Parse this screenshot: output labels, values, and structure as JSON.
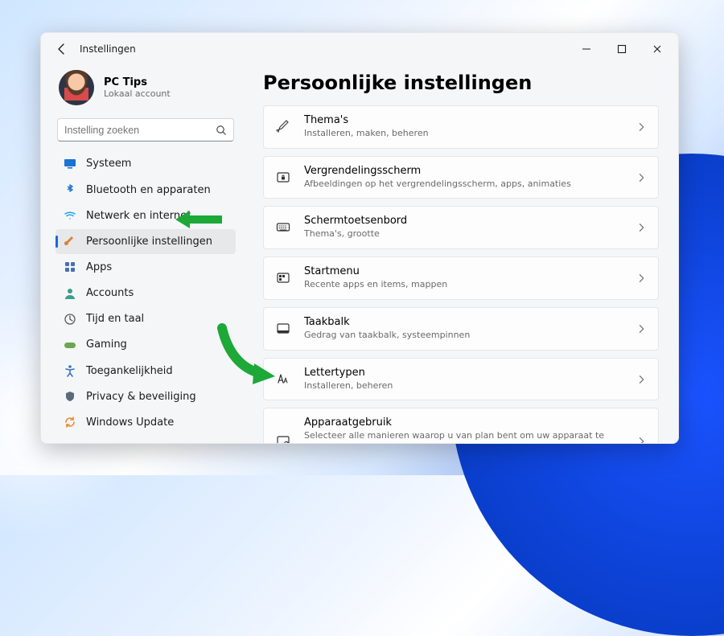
{
  "window": {
    "title": "Instellingen"
  },
  "user": {
    "name": "PC Tips",
    "subtitle": "Lokaal account"
  },
  "search": {
    "placeholder": "Instelling zoeken"
  },
  "sidebar": {
    "items": [
      {
        "label": "Systeem",
        "icon": "monitor",
        "color": "#1873d3"
      },
      {
        "label": "Bluetooth en apparaten",
        "icon": "bluetooth",
        "color": "#1873d3"
      },
      {
        "label": "Netwerk en internet",
        "icon": "wifi",
        "color": "#1aa0e6"
      },
      {
        "label": "Persoonlijke instellingen",
        "icon": "brush",
        "color": "#d9823b",
        "active": true
      },
      {
        "label": "Apps",
        "icon": "grid",
        "color": "#4a6fb0"
      },
      {
        "label": "Accounts",
        "icon": "person",
        "color": "#3aa08a"
      },
      {
        "label": "Tijd en taal",
        "icon": "globe-clock",
        "color": "#5a5a5a"
      },
      {
        "label": "Gaming",
        "icon": "gamepad",
        "color": "#6aa84f"
      },
      {
        "label": "Toegankelijkheid",
        "icon": "accessibility",
        "color": "#3b74c4"
      },
      {
        "label": "Privacy & beveiliging",
        "icon": "shield",
        "color": "#5a6a78"
      },
      {
        "label": "Windows Update",
        "icon": "update",
        "color": "#e68a2e"
      }
    ]
  },
  "page": {
    "title": "Persoonlijke instellingen",
    "items": [
      {
        "icon": "pen",
        "title": "Thema's",
        "subtitle": "Installeren, maken, beheren"
      },
      {
        "icon": "lockscreen",
        "title": "Vergrendelingsscherm",
        "subtitle": "Afbeeldingen op het vergrendelingsscherm, apps, animaties"
      },
      {
        "icon": "keyboard",
        "title": "Schermtoetsenbord",
        "subtitle": "Thema's, grootte"
      },
      {
        "icon": "start",
        "title": "Startmenu",
        "subtitle": "Recente apps en items, mappen"
      },
      {
        "icon": "taskbar",
        "title": "Taakbalk",
        "subtitle": "Gedrag van taakbalk, systeempinnen"
      },
      {
        "icon": "fonts",
        "title": "Lettertypen",
        "subtitle": "Installeren, beheren"
      },
      {
        "icon": "device",
        "title": "Apparaatgebruik",
        "subtitle": "Selecteer alle manieren waarop u van plan bent om uw apparaat te gebruiken om persoonlijke tips, advertenties en aanbevelingen te ontvangen in Microsoft-ervaringen."
      }
    ]
  }
}
